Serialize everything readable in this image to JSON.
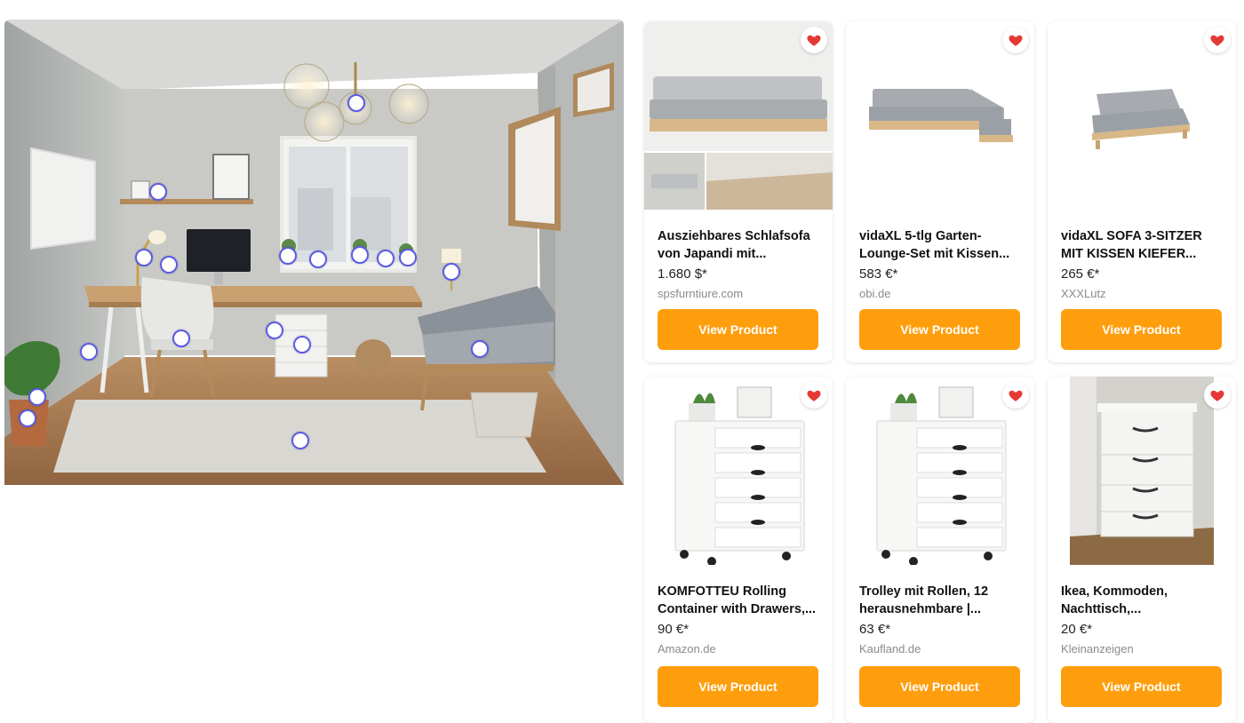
{
  "scene": {
    "hotspot_count": 20
  },
  "products": [
    {
      "title": "Ausziehbares Schlafsofa von Japandi mit...",
      "price": "1.680 $*",
      "store": "spsfurntiure.com",
      "button": "View Product",
      "image_icon": "sofa-photo",
      "favorited": true
    },
    {
      "title": "vidaXL 5-tlg Garten-Lounge-Set mit Kissen...",
      "price": "583 €*",
      "store": "obi.de",
      "button": "View Product",
      "image_icon": "corner-sofa-photo",
      "favorited": true
    },
    {
      "title": "vidaXL SOFA 3-SITZER MIT KISSEN KIEFER...",
      "price": "265 €*",
      "store": "XXXLutz",
      "button": "View Product",
      "image_icon": "three-seater-sofa-photo",
      "favorited": true
    },
    {
      "title": "KOMFOTTEU Rolling Container with Drawers,...",
      "price": "90 €*",
      "store": "Amazon.de",
      "button": "View Product",
      "image_icon": "drawer-cabinet-photo",
      "favorited": true
    },
    {
      "title": "Trolley mit Rollen, 12 herausnehmbare |...",
      "price": "63 €*",
      "store": "Kaufland.de",
      "button": "View Product",
      "image_icon": "drawer-cabinet-photo",
      "favorited": true
    },
    {
      "title": "Ikea, Kommoden, Nachttisch,...",
      "price": "20 €*",
      "store": "Kleinanzeigen",
      "button": "View Product",
      "image_icon": "dresser-photo",
      "favorited": true
    }
  ],
  "colors": {
    "accent": "#ff9e0d",
    "heart": "#e53935",
    "hotspot_border": "#5b5ce6",
    "store_text": "#8a8a8a"
  }
}
